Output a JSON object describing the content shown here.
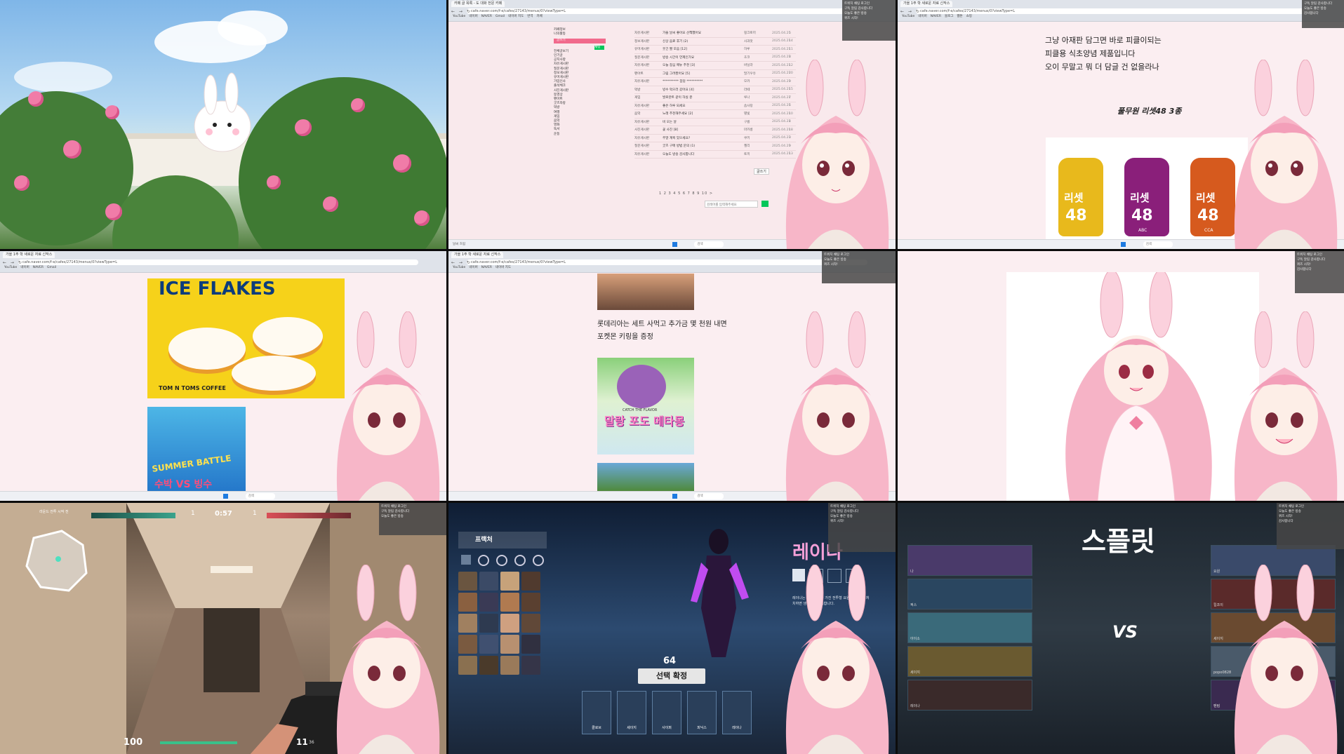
{
  "browser": {
    "tab_cafe": "카페 글 목록 - 도 대화 전문 카페",
    "tab_post": "가을 1주 학 새로운 자료 신작스",
    "address": "cafe.naver.com/f-e/cafes/27143/menus/0?viewType=L",
    "bookmarks": [
      "YouTube",
      "네이버",
      "NAVER",
      "Gmail",
      "네이버 지도",
      "번역",
      "카페",
      "블로그",
      "웹툰",
      "쇼핑"
    ]
  },
  "chat": [
    "트위치 채팅 로그인",
    "구독 알림 감사합니다",
    "오늘도 좋은 방송",
    "퀴즈 시작!",
    "감사합니다"
  ],
  "taskbar": {
    "search": "검색",
    "weather": "날씨 흐림"
  },
  "cafe": {
    "side_items": [
      "카페정보",
      "나의활동",
      "글쓰기",
      "채팅",
      "전체글보기",
      "인기글",
      "공지사항",
      "자유게시판",
      "질문게시판",
      "정보게시판",
      "유머게시판",
      "가입인사",
      "출석체크",
      "사진게시판",
      "동영상",
      "팬아트",
      "굿즈자랑",
      "먹방",
      "여행",
      "게임",
      "음악",
      "영화",
      "독서",
      "운동"
    ],
    "rows": [
      {
        "cat": "자유게시판",
        "title": "가을 날씨 좋아요 산책했어요",
        "author": "핑크토끼",
        "date": "2025.04.21",
        "views": "5"
      },
      {
        "cat": "정보게시판",
        "title": "신상 음료 후기 (2)",
        "author": "사과맛",
        "date": "2025.04.21",
        "views": "14"
      },
      {
        "cat": "유머게시판",
        "title": "웃긴 짤 모음 [12]",
        "author": "하루",
        "date": "2025.04.21",
        "views": "11"
      },
      {
        "cat": "질문게시판",
        "title": "방송 시간이 언제인가요",
        "author": "초코",
        "date": "2025.04.21",
        "views": "8"
      },
      {
        "cat": "자유게시판",
        "title": "오늘 점심 메뉴 추천 [3]",
        "author": "바닐라",
        "date": "2025.04.21",
        "views": "12"
      },
      {
        "cat": "팬아트",
        "title": "그림 그려봤어요 [5]",
        "author": "딸기우유",
        "date": "2025.04.21",
        "views": "20"
      },
      {
        "cat": "자유게시판",
        "title": "********** 잡담 **********",
        "author": "모카",
        "date": "2025.04.21",
        "views": "9"
      },
      {
        "cat": "먹방",
        "title": "빙수 먹으러 갔어요 [4]",
        "author": "라떼",
        "date": "2025.04.21",
        "views": "15"
      },
      {
        "cat": "게임",
        "title": "발로란트 같이 하실 분",
        "author": "루나",
        "date": "2025.04.21",
        "views": "7"
      },
      {
        "cat": "자유게시판",
        "title": "좋은 하루 되세요",
        "author": "솜사탕",
        "date": "2025.04.21",
        "views": "6"
      },
      {
        "cat": "음악",
        "title": "노래 추천해주세요 [2]",
        "author": "별빛",
        "date": "2025.04.21",
        "views": "10"
      },
      {
        "cat": "자유게시판",
        "title": "비 오는 날",
        "author": "구름",
        "date": "2025.04.21",
        "views": "4"
      },
      {
        "cat": "사진게시판",
        "title": "꽃 사진 [8]",
        "author": "마카롱",
        "date": "2025.04.21",
        "views": "18"
      },
      {
        "cat": "자유게시판",
        "title": "주말 계획 있으세요?",
        "author": "쿠키",
        "date": "2025.04.21",
        "views": "3"
      },
      {
        "cat": "질문게시판",
        "title": "굿즈 구매 방법 문의 (1)",
        "author": "젤리",
        "date": "2025.04.21",
        "views": "9"
      },
      {
        "cat": "자유게시판",
        "title": "오늘도 방송 감사합니다",
        "author": "토끼",
        "date": "2025.04.21",
        "views": "13"
      }
    ],
    "pagination": "1 2 3 4 5 6 7 8 9 10 >",
    "search_placeholder": "검색어를 입력해주세요",
    "write_button": "글쓰기"
  },
  "post": {
    "lines": [
      "그냥 아재판 담그면 바로 피클이되는",
      "피클용 식초양념 제품입니다",
      "오이 무말고 뭐 더 담글 건 없을라나"
    ],
    "product_title": "풀무원 리셋48 3종",
    "bottles": [
      {
        "label": "리셋",
        "num": "48",
        "sub": "",
        "color": "#e8b91c"
      },
      {
        "label": "리셋",
        "num": "48",
        "sub": "ABC",
        "color": "#8a1f7a"
      },
      {
        "label": "리셋",
        "num": "48",
        "sub": "CCA",
        "color": "#d65a1e"
      }
    ]
  },
  "ice": {
    "title": "ICE FLAKES",
    "brand": "TOM N TOMS COFFEE",
    "summer": "SUMMER BATTLE",
    "summer2": "수박 VS 빙수"
  },
  "t5": {
    "text": [
      "롯데리아는 세트 사먹고 추가금 몇 천원 내면",
      "포켓몬 키링을 증정"
    ],
    "grape_kicker": "CATCH THE FLAVOR",
    "grape_title": "말랑 포도 메타몽"
  },
  "val": {
    "mission": "라운드 전투 시작 전",
    "time": "0:57",
    "score_left": "1",
    "score_right": "1",
    "hp": "100",
    "ammo": "11",
    "ammo_reserve": "36"
  },
  "agent": {
    "role": "프랙처",
    "agent_name": "레이나",
    "timer": "64",
    "lock": "선택 확정",
    "desc": "레이나는 흡수 능력을 가진 전투형 요원으로, 적을 처치하면 생명력을 회복합니다.",
    "team": [
      "클로브",
      "세이지",
      "사이퍼",
      "피닉스",
      "레이나"
    ]
  },
  "versus": {
    "map": "스플릿",
    "vs": "VS",
    "left_names": [
      "나",
      "픽스",
      "아이소",
      "세이지",
      "레이나"
    ],
    "right_names": [
      "요원",
      "킬조이",
      "세이지",
      "popo0828",
      "팬텀"
    ]
  },
  "colors": {
    "pink_bg": "#fbeef1",
    "accent_green": "#03c75a",
    "valorant_red": "#ff4655"
  }
}
